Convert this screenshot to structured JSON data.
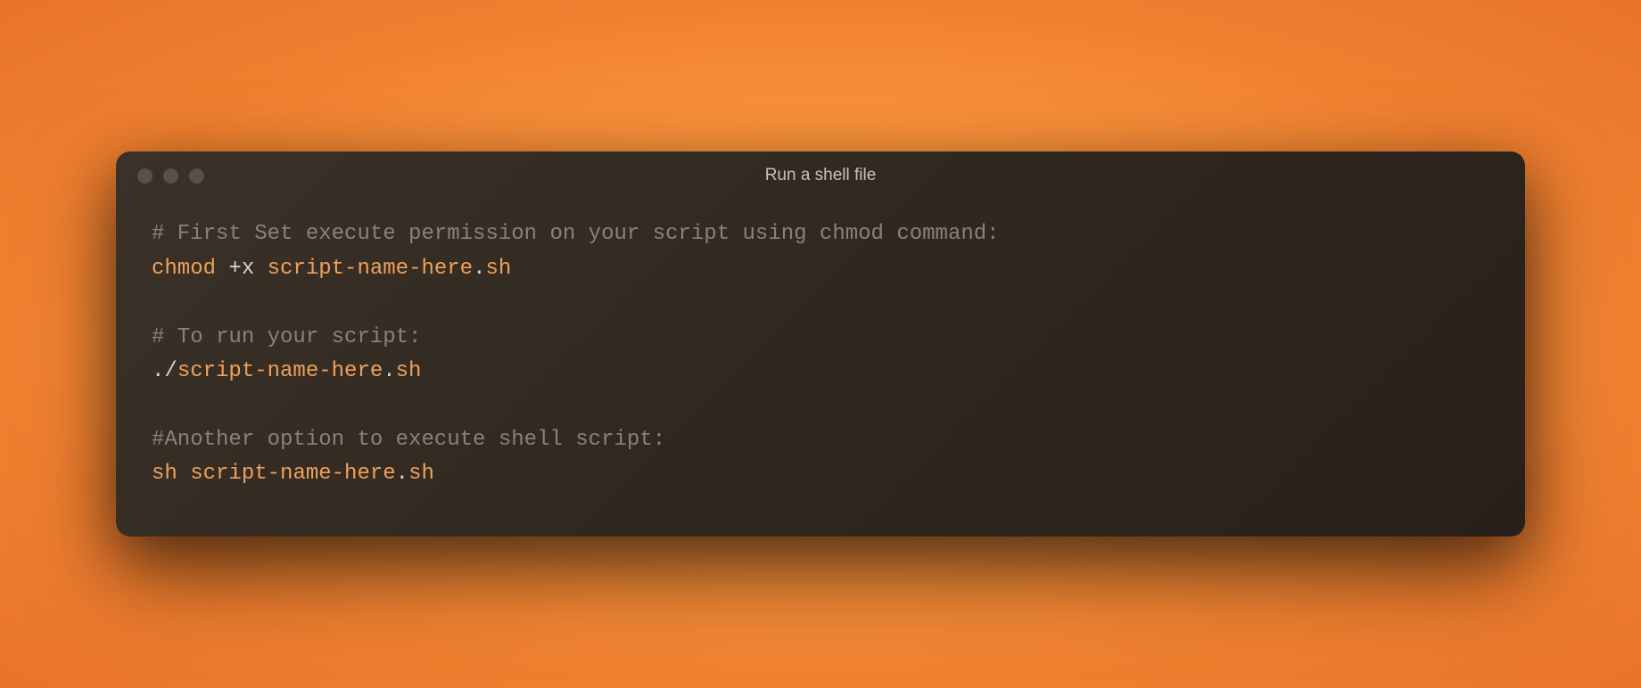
{
  "window": {
    "title": "Run a shell file"
  },
  "code": {
    "lines": [
      {
        "tokens": [
          {
            "cls": "tok-comment",
            "text": "# First Set execute permission on your script using chmod command:"
          }
        ]
      },
      {
        "tokens": [
          {
            "cls": "tok-cmd",
            "text": "chmod "
          },
          {
            "cls": "tok-punct",
            "text": "+"
          },
          {
            "cls": "tok-plain",
            "text": "x "
          },
          {
            "cls": "tok-arg",
            "text": "script-name-here"
          },
          {
            "cls": "tok-punct",
            "text": "."
          },
          {
            "cls": "tok-arg",
            "text": "sh"
          }
        ]
      },
      {
        "tokens": []
      },
      {
        "tokens": [
          {
            "cls": "tok-comment",
            "text": "# To run your script:"
          }
        ]
      },
      {
        "tokens": [
          {
            "cls": "tok-punct",
            "text": "./"
          },
          {
            "cls": "tok-arg",
            "text": "script-name-here"
          },
          {
            "cls": "tok-punct",
            "text": "."
          },
          {
            "cls": "tok-arg",
            "text": "sh"
          }
        ]
      },
      {
        "tokens": []
      },
      {
        "tokens": [
          {
            "cls": "tok-comment",
            "text": "#Another option to execute shell script:"
          }
        ]
      },
      {
        "tokens": [
          {
            "cls": "tok-cmd",
            "text": "sh "
          },
          {
            "cls": "tok-arg",
            "text": "script-name-here"
          },
          {
            "cls": "tok-punct",
            "text": "."
          },
          {
            "cls": "tok-arg",
            "text": "sh"
          }
        ]
      }
    ]
  }
}
